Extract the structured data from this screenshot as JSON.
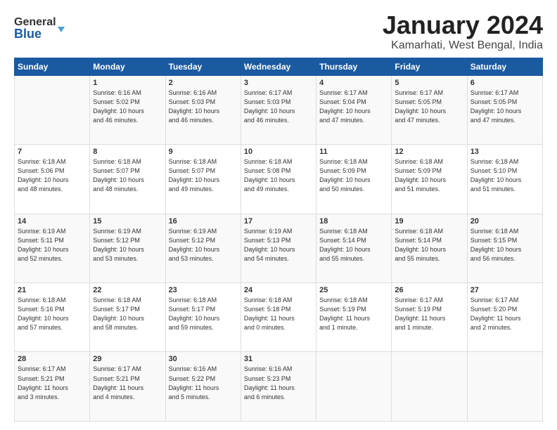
{
  "header": {
    "logo_general": "General",
    "logo_blue": "Blue",
    "month_title": "January 2024",
    "location": "Kamarhati, West Bengal, India"
  },
  "days_of_week": [
    "Sunday",
    "Monday",
    "Tuesday",
    "Wednesday",
    "Thursday",
    "Friday",
    "Saturday"
  ],
  "weeks": [
    [
      {
        "day": "",
        "info": ""
      },
      {
        "day": "1",
        "info": "Sunrise: 6:16 AM\nSunset: 5:02 PM\nDaylight: 10 hours\nand 46 minutes."
      },
      {
        "day": "2",
        "info": "Sunrise: 6:16 AM\nSunset: 5:03 PM\nDaylight: 10 hours\nand 46 minutes."
      },
      {
        "day": "3",
        "info": "Sunrise: 6:17 AM\nSunset: 5:03 PM\nDaylight: 10 hours\nand 46 minutes."
      },
      {
        "day": "4",
        "info": "Sunrise: 6:17 AM\nSunset: 5:04 PM\nDaylight: 10 hours\nand 47 minutes."
      },
      {
        "day": "5",
        "info": "Sunrise: 6:17 AM\nSunset: 5:05 PM\nDaylight: 10 hours\nand 47 minutes."
      },
      {
        "day": "6",
        "info": "Sunrise: 6:17 AM\nSunset: 5:05 PM\nDaylight: 10 hours\nand 47 minutes."
      }
    ],
    [
      {
        "day": "7",
        "info": "Sunrise: 6:18 AM\nSunset: 5:06 PM\nDaylight: 10 hours\nand 48 minutes."
      },
      {
        "day": "8",
        "info": "Sunrise: 6:18 AM\nSunset: 5:07 PM\nDaylight: 10 hours\nand 48 minutes."
      },
      {
        "day": "9",
        "info": "Sunrise: 6:18 AM\nSunset: 5:07 PM\nDaylight: 10 hours\nand 49 minutes."
      },
      {
        "day": "10",
        "info": "Sunrise: 6:18 AM\nSunset: 5:08 PM\nDaylight: 10 hours\nand 49 minutes."
      },
      {
        "day": "11",
        "info": "Sunrise: 6:18 AM\nSunset: 5:09 PM\nDaylight: 10 hours\nand 50 minutes."
      },
      {
        "day": "12",
        "info": "Sunrise: 6:18 AM\nSunset: 5:09 PM\nDaylight: 10 hours\nand 51 minutes."
      },
      {
        "day": "13",
        "info": "Sunrise: 6:18 AM\nSunset: 5:10 PM\nDaylight: 10 hours\nand 51 minutes."
      }
    ],
    [
      {
        "day": "14",
        "info": "Sunrise: 6:19 AM\nSunset: 5:11 PM\nDaylight: 10 hours\nand 52 minutes."
      },
      {
        "day": "15",
        "info": "Sunrise: 6:19 AM\nSunset: 5:12 PM\nDaylight: 10 hours\nand 53 minutes."
      },
      {
        "day": "16",
        "info": "Sunrise: 6:19 AM\nSunset: 5:12 PM\nDaylight: 10 hours\nand 53 minutes."
      },
      {
        "day": "17",
        "info": "Sunrise: 6:19 AM\nSunset: 5:13 PM\nDaylight: 10 hours\nand 54 minutes."
      },
      {
        "day": "18",
        "info": "Sunrise: 6:18 AM\nSunset: 5:14 PM\nDaylight: 10 hours\nand 55 minutes."
      },
      {
        "day": "19",
        "info": "Sunrise: 6:18 AM\nSunset: 5:14 PM\nDaylight: 10 hours\nand 55 minutes."
      },
      {
        "day": "20",
        "info": "Sunrise: 6:18 AM\nSunset: 5:15 PM\nDaylight: 10 hours\nand 56 minutes."
      }
    ],
    [
      {
        "day": "21",
        "info": "Sunrise: 6:18 AM\nSunset: 5:16 PM\nDaylight: 10 hours\nand 57 minutes."
      },
      {
        "day": "22",
        "info": "Sunrise: 6:18 AM\nSunset: 5:17 PM\nDaylight: 10 hours\nand 58 minutes."
      },
      {
        "day": "23",
        "info": "Sunrise: 6:18 AM\nSunset: 5:17 PM\nDaylight: 10 hours\nand 59 minutes."
      },
      {
        "day": "24",
        "info": "Sunrise: 6:18 AM\nSunset: 5:18 PM\nDaylight: 11 hours\nand 0 minutes."
      },
      {
        "day": "25",
        "info": "Sunrise: 6:18 AM\nSunset: 5:19 PM\nDaylight: 11 hours\nand 1 minute."
      },
      {
        "day": "26",
        "info": "Sunrise: 6:17 AM\nSunset: 5:19 PM\nDaylight: 11 hours\nand 1 minute."
      },
      {
        "day": "27",
        "info": "Sunrise: 6:17 AM\nSunset: 5:20 PM\nDaylight: 11 hours\nand 2 minutes."
      }
    ],
    [
      {
        "day": "28",
        "info": "Sunrise: 6:17 AM\nSunset: 5:21 PM\nDaylight: 11 hours\nand 3 minutes."
      },
      {
        "day": "29",
        "info": "Sunrise: 6:17 AM\nSunset: 5:21 PM\nDaylight: 11 hours\nand 4 minutes."
      },
      {
        "day": "30",
        "info": "Sunrise: 6:16 AM\nSunset: 5:22 PM\nDaylight: 11 hours\nand 5 minutes."
      },
      {
        "day": "31",
        "info": "Sunrise: 6:16 AM\nSunset: 5:23 PM\nDaylight: 11 hours\nand 6 minutes."
      },
      {
        "day": "",
        "info": ""
      },
      {
        "day": "",
        "info": ""
      },
      {
        "day": "",
        "info": ""
      }
    ]
  ]
}
